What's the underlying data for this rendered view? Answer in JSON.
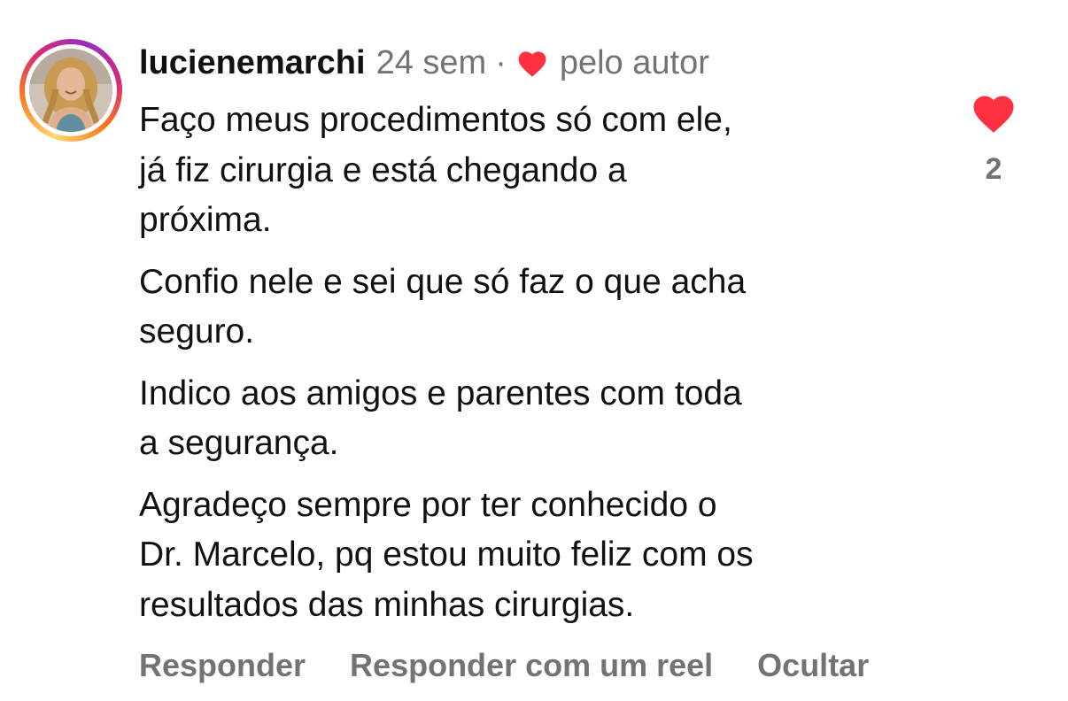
{
  "comment": {
    "username": "lucienemarchi",
    "time": "24 sem",
    "separator": "·",
    "author_like_label": "pelo autor",
    "author_like_icon": "heart-icon",
    "paragraphs": [
      {
        "lines": [
          "Faço meus procedimentos só com ele,",
          "já fiz cirurgia e está chegando a",
          "próxima."
        ]
      },
      {
        "lines": [
          "Confio nele e sei que só faz o que acha",
          "seguro."
        ]
      },
      {
        "lines": [
          "Indico aos amigos e parentes com toda",
          "a segurança."
        ]
      },
      {
        "lines": [
          "Agradeço sempre por ter conhecido o",
          "Dr. Marcelo, pq estou muito feliz com os",
          "resultados das minhas cirurgias."
        ]
      }
    ],
    "like_count": "2",
    "liked": true,
    "actions": {
      "reply": "Responder",
      "reply_reel": "Responder com um reel",
      "hide": "Ocultar"
    }
  },
  "colors": {
    "heart": "#ff3040",
    "muted_text": "#737373",
    "text": "#111111"
  }
}
